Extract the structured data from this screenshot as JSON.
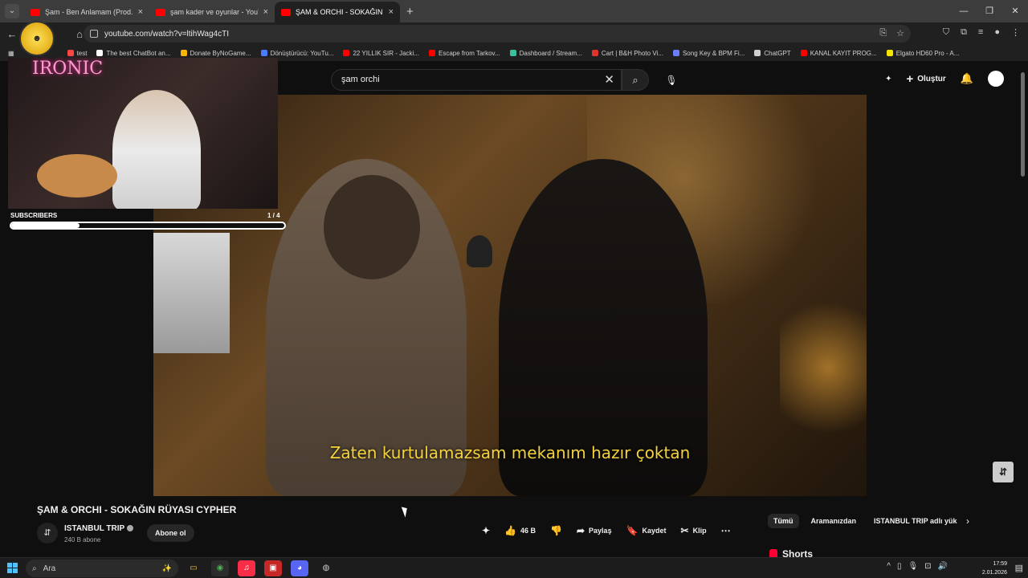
{
  "browser": {
    "tabs": [
      {
        "label": "Şam - Ben Anlamam (Prod. by o",
        "active": false
      },
      {
        "label": "şam kader ve oyunlar - YouTub",
        "active": false
      },
      {
        "label": "ŞAM & ORCHI - SOKAĞIN RÜ",
        "active": true
      }
    ],
    "url": "youtube.com/watch?v=ltihWag4cTI",
    "bookmarks": [
      {
        "label": "test",
        "color": "#ff4444"
      },
      {
        "label": "The best ChatBot an...",
        "color": "#ffffff"
      },
      {
        "label": "Donate ByNoGame...",
        "color": "#f5b400"
      },
      {
        "label": "Dönüştürücü: YouTu...",
        "color": "#4a7cff"
      },
      {
        "label": "22 YILLIK SIR - Jacki...",
        "color": "#ff0000"
      },
      {
        "label": "Escape from Tarkov...",
        "color": "#ff0000"
      },
      {
        "label": "Dashboard / Stream...",
        "color": "#3ac0a0"
      },
      {
        "label": "Cart | B&H Photo Vi...",
        "color": "#e0332e"
      },
      {
        "label": "Song Key & BPM Fi...",
        "color": "#6a7cff"
      },
      {
        "label": "ChatGPT",
        "color": "#cfcfcf"
      },
      {
        "label": "KANAL KAYIT PROG...",
        "color": "#ff0000"
      },
      {
        "label": "Elgato HD60 Pro - A...",
        "color": "#f5e400"
      }
    ]
  },
  "youtube": {
    "search_query": "şam orchi",
    "create_label": "Oluştur",
    "video": {
      "subtitle": "Zaten kurtulamazsam mekanım hazır çoktan",
      "title": "ŞAM & ORCHI - SOKAĞIN RÜYASI CYPHER"
    },
    "channel": {
      "name": "ISTANBUL TRIP",
      "subscribers": "240 B abone",
      "subscribe_label": "Abone ol"
    },
    "actions": {
      "likes": "46 B",
      "share": "Paylaş",
      "save": "Kaydet",
      "clip": "Klip"
    },
    "chips": [
      "Tümü",
      "Aramanızdan",
      "ISTANBUL TRIP adlı yük"
    ],
    "shorts_label": "Shorts"
  },
  "overlay": {
    "brand": "IRONIC",
    "subscribers_label": "SUBSCRIBERS",
    "subscribers_count": "1 / 4",
    "progress_fraction": 0.25
  },
  "taskbar": {
    "search_placeholder": "Ara",
    "time": "17:59",
    "date": "2.01.2026"
  },
  "colors": {
    "accent": "#ff0000",
    "subtitle": "#f3d23e"
  }
}
